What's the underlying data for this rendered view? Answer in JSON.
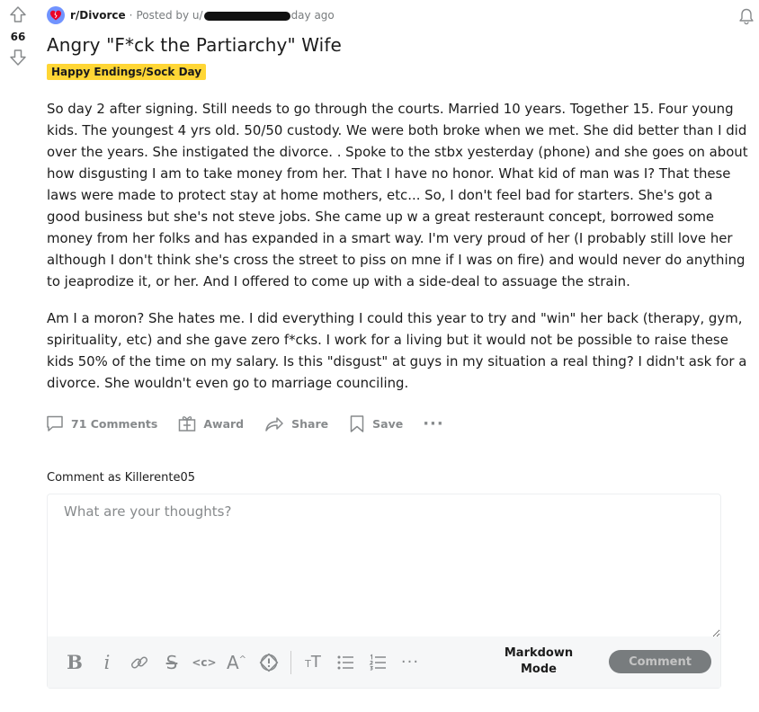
{
  "post": {
    "subreddit": "r/Divorce",
    "posted_by_prefix": "Posted by u/",
    "time_suffix": "day ago",
    "score": "66",
    "title": "Angry \"F*ck the Partiarchy\" Wife",
    "flair": "Happy Endings/Sock Day",
    "paragraphs": [
      "So day 2 after signing. Still needs to go through the courts. Married 10 years. Together 15. Four young kids. The youngest 4 yrs old. 50/50 custody. We were both broke when we met. She did better than I did over the years. She instigated the divorce. . Spoke to the stbx yesterday (phone) and she goes on about how disgusting I am to take money from her. That I have no honor. What kid of man was I? That these laws were made to protect stay at home mothers, etc... So, I don't feel bad for starters. She's got a good business but she's not steve jobs. She came up w a great resteraunt concept, borrowed some money from her folks and has expanded in a smart way. I'm very proud of her (I probably still love her although I don't think she's cross the street to piss on mne if I was on fire) and would never do anything to jeaprodize it, or her. And I offered to come up with a side-deal to assuage the strain.",
      "Am I a moron? She hates me. I did everything I could this year to try and \"win\" her back (therapy, gym, spirituality, etc) and she gave zero f*cks. I work for a living but it would not be possible to raise these kids 50% of the time on my salary. Is this \"disgust\" at guys in my situation a real thing? I didn't ask for a divorce. She wouldn't even go to marriage counciling."
    ]
  },
  "actions": {
    "comments": "71 Comments",
    "award": "Award",
    "share": "Share",
    "save": "Save",
    "more": "···"
  },
  "comment_box": {
    "comment_as": "Comment as Killerente05",
    "placeholder": "What are your thoughts?",
    "markdown_line1": "Markdown",
    "markdown_line2": "Mode",
    "submit": "Comment"
  },
  "colors": {
    "flair_bg": "#ffd635",
    "icon_gray": "#878a8c",
    "avatar_blue": "#7193ff"
  },
  "icons": [
    "upvote-icon",
    "downvote-icon",
    "subreddit-icon",
    "bell-icon",
    "comment-icon",
    "award-icon",
    "share-icon",
    "save-icon",
    "more-icon",
    "bold-icon",
    "italic-icon",
    "link-icon",
    "strikethrough-icon",
    "inline-code-icon",
    "superscript-icon",
    "spoiler-icon",
    "heading-icon",
    "bulleted-list-icon",
    "numbered-list-icon",
    "toolbar-more-icon"
  ]
}
